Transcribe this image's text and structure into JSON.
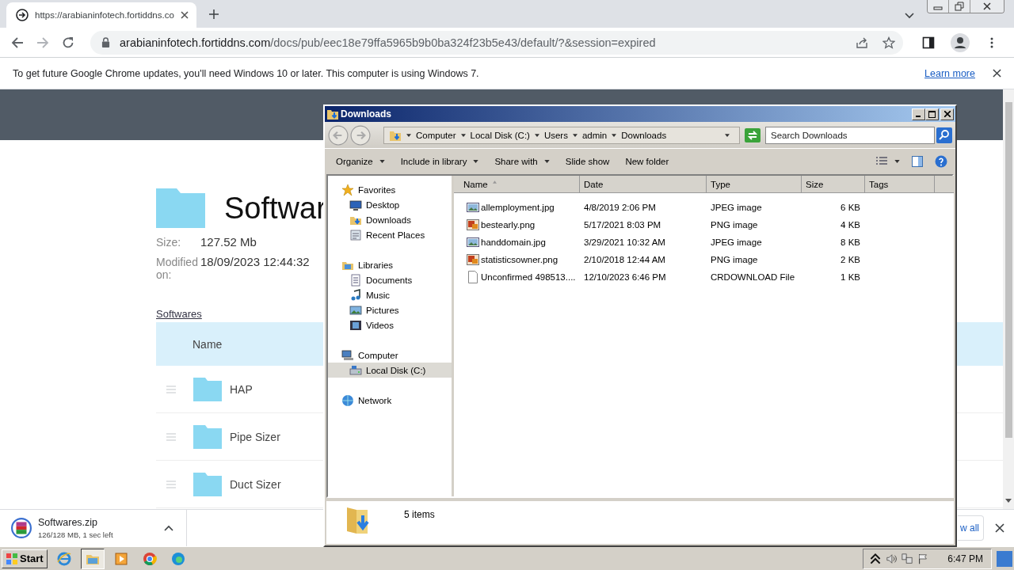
{
  "browser": {
    "tab": {
      "title": "https://arabianinfotech.fortiddns.co"
    },
    "address": {
      "host": "arabianinfotech.fortiddns.com",
      "path": "/docs/pub/eec18e79ffa5965b9b0ba324f23b5e43/default/?&session=expired"
    },
    "infobar": {
      "message": "To get future Google Chrome updates, you'll need Windows 10 or later. This computer is using Windows 7.",
      "link": "Learn more"
    },
    "page": {
      "title": "Softwar",
      "size_label": "Size:",
      "size": "127.52 Mb",
      "modified_label": "Modified on:",
      "modified": "18/09/2023 12:44:32",
      "breadcrumb": "Softwares",
      "column": "Name",
      "rows": [
        {
          "name": "HAP"
        },
        {
          "name": "Pipe Sizer"
        },
        {
          "name": "Duct Sizer"
        }
      ]
    },
    "download": {
      "filename": "Softwares.zip",
      "status": "126/128 MB, 1 sec left",
      "show_all": "w all"
    }
  },
  "explorer": {
    "title": "Downloads",
    "path": [
      "Computer",
      "Local Disk (C:)",
      "Users",
      "admin",
      "Downloads"
    ],
    "search": {
      "placeholder": "Search Downloads"
    },
    "toolbar": [
      {
        "label": "Organize",
        "menu": true
      },
      {
        "label": "Include in library",
        "menu": true
      },
      {
        "label": "Share with",
        "menu": true
      },
      {
        "label": "Slide show",
        "menu": false
      },
      {
        "label": "New folder",
        "menu": false
      }
    ],
    "nav": [
      {
        "label": "Favorites",
        "kind": "star",
        "selected": false,
        "children": [
          {
            "label": "Desktop",
            "kind": "desktop",
            "selected": false
          },
          {
            "label": "Downloads",
            "kind": "downloads",
            "selected": false
          },
          {
            "label": "Recent Places",
            "kind": "places",
            "selected": false
          }
        ]
      },
      {
        "label": "Libraries",
        "kind": "library",
        "selected": false,
        "children": [
          {
            "label": "Documents",
            "kind": "documents",
            "selected": false
          },
          {
            "label": "Music",
            "kind": "music",
            "selected": false
          },
          {
            "label": "Pictures",
            "kind": "pictures",
            "selected": false
          },
          {
            "label": "Videos",
            "kind": "videos",
            "selected": false
          }
        ]
      },
      {
        "label": "Computer",
        "kind": "computer",
        "selected": false,
        "children": [
          {
            "label": "Local Disk (C:)",
            "kind": "disk",
            "selected": true
          }
        ]
      },
      {
        "label": "Network",
        "kind": "network",
        "selected": false
      }
    ],
    "columns": [
      "Name",
      "Date",
      "Type",
      "Size",
      "Tags"
    ],
    "files": [
      {
        "name": "allemployment.jpg",
        "date": "4/8/2019 2:06 PM",
        "type": "JPEG image",
        "size": "6 KB",
        "kind": "jpg"
      },
      {
        "name": "bestearly.png",
        "date": "5/17/2021 8:03 PM",
        "type": "PNG image",
        "size": "4 KB",
        "kind": "png"
      },
      {
        "name": "handdomain.jpg",
        "date": "3/29/2021 10:32 AM",
        "type": "JPEG image",
        "size": "8 KB",
        "kind": "jpg"
      },
      {
        "name": "statisticsowner.png",
        "date": "2/10/2018 12:44 AM",
        "type": "PNG image",
        "size": "2 KB",
        "kind": "png"
      },
      {
        "name": "Unconfirmed 498513....",
        "date": "12/10/2023 6:46 PM",
        "type": "CRDOWNLOAD File",
        "size": "1 KB",
        "kind": "file"
      }
    ],
    "status": "5 items"
  },
  "taskbar": {
    "start": "Start",
    "apps": [
      {
        "kind": "ie",
        "selected": false
      },
      {
        "kind": "explorer",
        "selected": true
      },
      {
        "kind": "media",
        "selected": false
      },
      {
        "kind": "chrome",
        "selected": false
      },
      {
        "kind": "edge",
        "selected": false
      }
    ],
    "clock": "6:47 PM"
  }
}
